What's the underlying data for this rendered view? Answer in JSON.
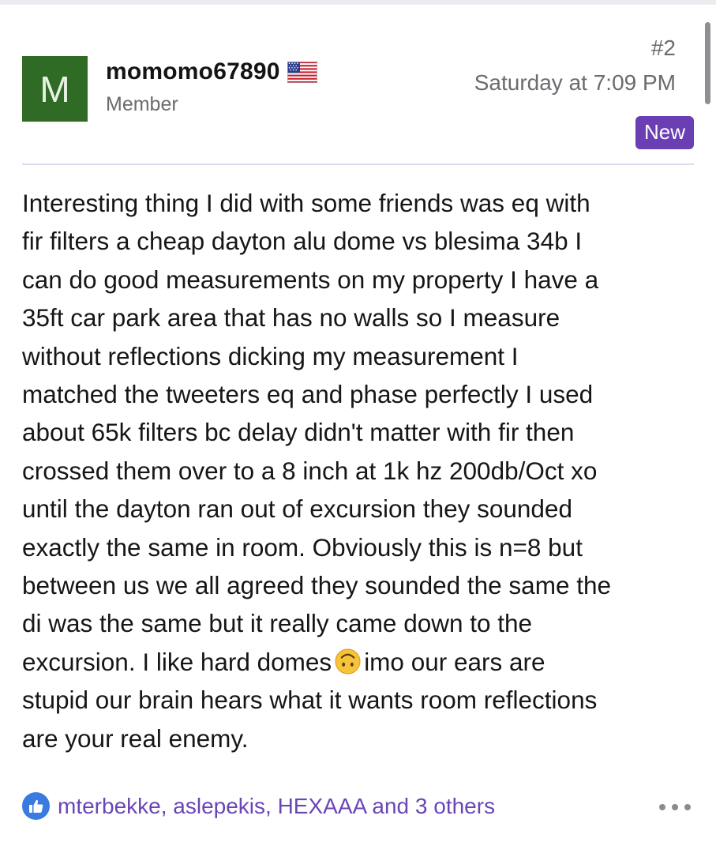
{
  "post": {
    "avatar_letter": "M",
    "username": "momomo67890",
    "flag_icon": "us-flag-icon",
    "role": "Member",
    "number": "#2",
    "timestamp": "Saturday at 7:09 PM",
    "badge": "New",
    "body_lines": [
      "Interesting thing I did with some friends was eq with",
      "fir filters a cheap dayton alu dome vs blesima 34b I",
      "can do good measurements on my property I have a",
      "35ft car park area that has no walls so I measure",
      "without reflections dicking my measurement I",
      "matched the tweeters eq and phase perfectly I used",
      "about 65k filters bc delay didn't matter with fir then",
      "crossed them over to a 8 inch at 1k hz 200db/Oct xo",
      "until the dayton ran out of excursion they sounded",
      "exactly the same in room. Obviously this is n=8 but",
      "between us we all agreed they sounded the same the",
      "di was the same but it really came down to the"
    ],
    "body_line_13_before": "excursion. I like hard domes",
    "body_line_13_emoji": "upside-down-face-emoji",
    "body_line_13_after": "imo our ears are",
    "body_line_14": "stupid our brain hears what it wants room reflections",
    "body_line_15": "are your real enemy.",
    "reactions_text": "mterbekke, aslepekis, HEXAAA and 3 others",
    "reaction_icon": "thumbs-up-icon",
    "more_icon": "more-options-icon"
  },
  "colors": {
    "avatar_bg": "#2f6b25",
    "badge_bg": "#6a3fb4",
    "link": "#6a46b5",
    "like": "#3a7be0"
  }
}
